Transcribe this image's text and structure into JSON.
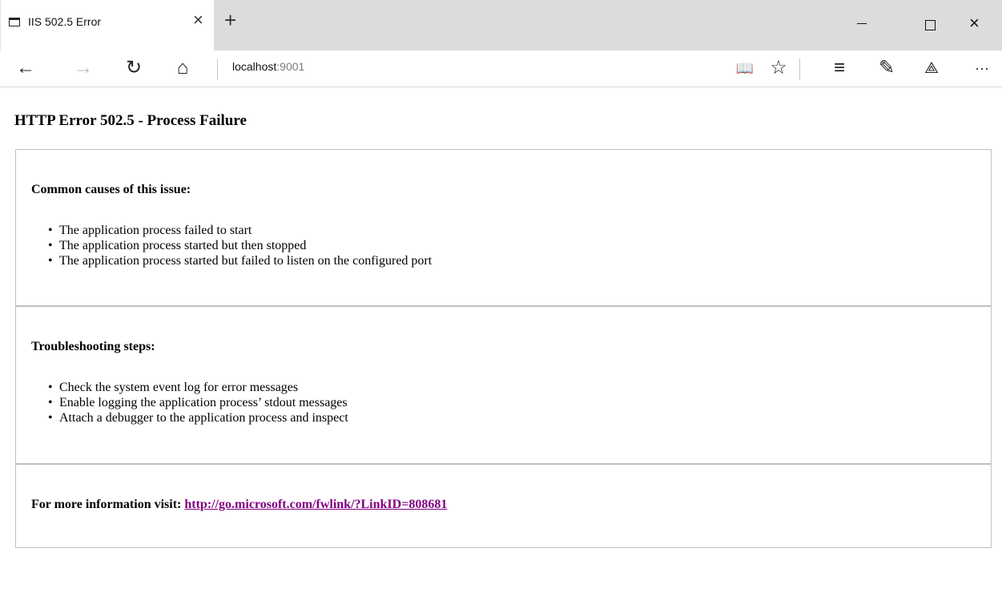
{
  "browser": {
    "tab_title": "IIS 502.5 Error",
    "tab_close": "×",
    "new_tab": "+",
    "window": {
      "minimize": "",
      "maximize": "",
      "close": "×"
    },
    "nav": {
      "back": "←",
      "forward": "→",
      "refresh": "↻",
      "home": "⌂",
      "reading_view": "📖",
      "favorite": "☆",
      "hub": "≡",
      "web_note": "✎",
      "share": "⟁",
      "more": "···"
    },
    "address": {
      "host": "localhost",
      "port": ":9001"
    }
  },
  "page": {
    "title": "HTTP Error 502.5 - Process Failure",
    "causes": {
      "heading": "Common causes of this issue:",
      "items": [
        "The application process failed to start",
        "The application process started but then stopped",
        "The application process started but failed to listen on the configured port"
      ]
    },
    "troubleshooting": {
      "heading": "Troubleshooting steps:",
      "items": [
        "Check the system event log for error messages",
        "Enable logging the application process’ stdout messages",
        "Attach a debugger to the application process and inspect"
      ]
    },
    "more_info": {
      "label": "For more information visit:",
      "link_text": "http://go.microsoft.com/fwlink/?LinkID=808681"
    }
  },
  "colors": {
    "link": "#800080",
    "border": "#c0c0c0",
    "tabstrip": "#dcdcdc"
  }
}
